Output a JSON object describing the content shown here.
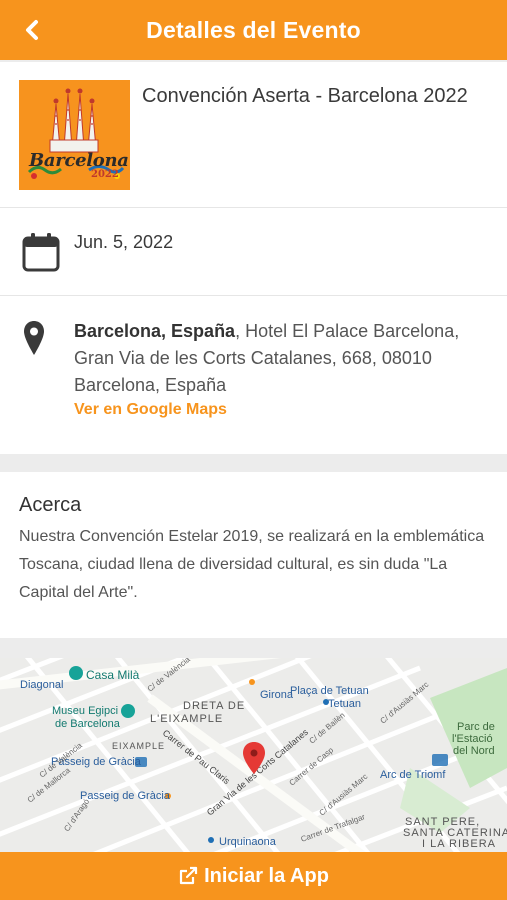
{
  "header": {
    "title": "Detalles del Evento",
    "back_icon": "chevron-left-icon"
  },
  "event": {
    "title": "Convención Aserta - Barcelona 2022",
    "logo": {
      "word": "Barcelona",
      "year": "2022"
    },
    "date": "Jun. 5, 2022",
    "location_bold": "Barcelona, España",
    "location_rest": ", Hotel El Palace Barcelona, Gran Via de les Corts Catalanes, 668, 08010 Barcelona, España",
    "maps_link": "Ver en Google Maps"
  },
  "about": {
    "heading": "Acerca",
    "text": "Nuestra Convención Estelar 2019, se realizará en la emblemática Toscana, ciudad llena de diversidad cultural, es sin duda \"La Capital del Arte\"."
  },
  "map": {
    "labels": {
      "casa_mila": "Casa Milà",
      "diagonal": "Diagonal",
      "valencia1": "C/ de València",
      "dreta1": "DRETA DE",
      "dreta2": "L'EIXAMPLE",
      "girona": "Girona",
      "placa": "Plaça de Tetuan",
      "tetuan": "Tetuan",
      "ausias1": "C/ d'Ausiàs Marc",
      "parc1": "Parc de",
      "parc2": "l'Estació",
      "parc3": "del Nord",
      "museu1": "Museu Egipci",
      "museu2": "de Barcelona",
      "eixample": "EIXAMPLE",
      "pau_claris": "Carrer de Pau Claris",
      "gran_via": "Gran Via de les Corts Catalanes",
      "bailen": "C/ de Bailèn",
      "arc": "Arc de Triomf",
      "passeig1": "Passeig de Gràcia",
      "passeig2": "Passeig de Gràcia",
      "mallorca": "C/ de Mallorca",
      "valencia2": "C/ de València",
      "arago": "C/ d'Aragó",
      "casp": "Carrer de Casp",
      "ausias2": "C/ d'Ausiàs Marc",
      "urquinaona": "Urquinaona",
      "trafalgar": "Carrer de Trafalgar",
      "sant1": "SANT PERE,",
      "sant2": "SANTA CATERINA",
      "sant3": "I LA RIBERA"
    }
  },
  "footer": {
    "launch_label": "Iniciar la App",
    "launch_icon": "external-link-icon"
  },
  "colors": {
    "accent": "#f7941d",
    "text": "#3a3a3a",
    "muted": "#555555"
  }
}
